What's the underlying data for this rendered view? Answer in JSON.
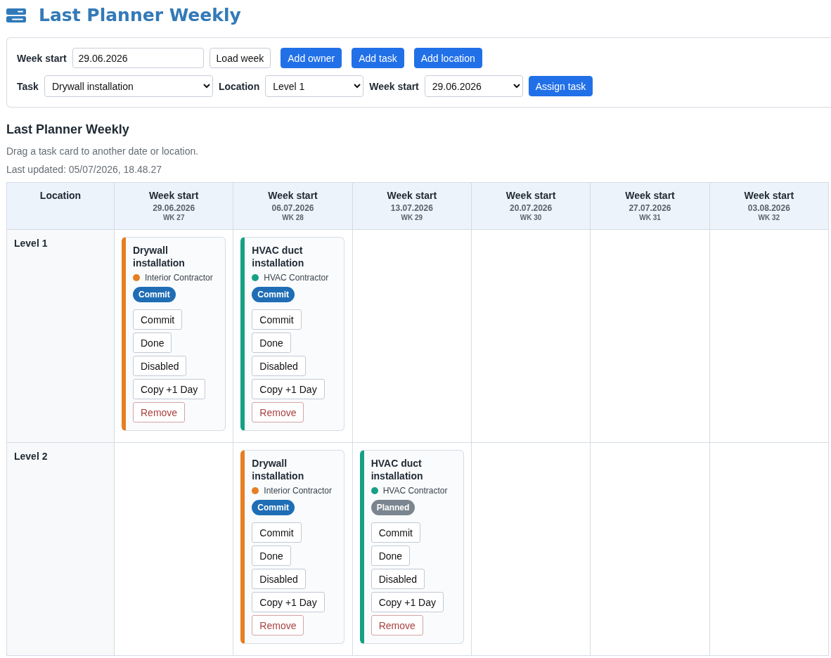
{
  "header": {
    "title": "Last Planner Weekly"
  },
  "toolbar": {
    "week_field": {
      "label": "Week start",
      "value": "29.06.2026"
    },
    "buttons": [
      {
        "label": "Load week",
        "kind": "load"
      },
      {
        "label": "Add owner",
        "kind": "add"
      },
      {
        "label": "Add task",
        "kind": "add"
      },
      {
        "label": "Add location",
        "kind": "add"
      }
    ],
    "task_field": {
      "label": "Task",
      "value": "Drywall installation"
    },
    "location_field": {
      "label": "Location",
      "value": "Level 1"
    },
    "assign_week_field": {
      "label": "Week start",
      "value": "29.06.2026"
    },
    "assign_button": {
      "label": "Assign task",
      "kind": "assign"
    }
  },
  "board": {
    "title": "Last Planner Weekly",
    "hint": "Drag a task card to another date or location.",
    "last_updated": "Last updated: 05/07/2026, 18.48.27",
    "corner": "Location",
    "columns": [
      {
        "label": "Week start",
        "date": "29.06.2026",
        "week": "WK 27"
      },
      {
        "label": "Week start",
        "date": "06.07.2026",
        "week": "WK 28"
      },
      {
        "label": "Week start",
        "date": "13.07.2026",
        "week": "WK 29"
      },
      {
        "label": "Week start",
        "date": "20.07.2026",
        "week": "WK 30"
      },
      {
        "label": "Week start",
        "date": "27.07.2026",
        "week": "WK 31"
      },
      {
        "label": "Week start",
        "date": "03.08.2026",
        "week": "WK 32"
      }
    ],
    "rows": [
      {
        "location": "Level 1",
        "cells": [
          {
            "kind": "card",
            "title": "Drywall installation",
            "owner": "Interior Contractor",
            "color": "#e67e22",
            "status": {
              "label": "Commit",
              "kind": "commit"
            },
            "actions": [
              {
                "label": "Commit",
                "kind": "commit"
              },
              {
                "label": "Done",
                "kind": "done"
              },
              {
                "label": "Disabled",
                "kind": "disable"
              },
              {
                "label": "Copy +1 Day",
                "kind": "copy"
              },
              {
                "label": "Remove",
                "kind": "remove"
              }
            ]
          },
          {
            "kind": "card",
            "title": "HVAC duct installation",
            "owner": "HVAC Contractor",
            "color": "#16a085",
            "status": {
              "label": "Commit",
              "kind": "commit"
            },
            "actions": [
              {
                "label": "Commit",
                "kind": "commit"
              },
              {
                "label": "Done",
                "kind": "done"
              },
              {
                "label": "Disabled",
                "kind": "disable"
              },
              {
                "label": "Copy +1 Day",
                "kind": "copy"
              },
              {
                "label": "Remove",
                "kind": "remove"
              }
            ]
          },
          {
            "kind": "empty"
          },
          {
            "kind": "empty"
          },
          {
            "kind": "empty"
          },
          {
            "kind": "empty"
          }
        ]
      },
      {
        "location": "Level 2",
        "cells": [
          {
            "kind": "empty"
          },
          {
            "kind": "card",
            "title": "Drywall installation",
            "owner": "Interior Contractor",
            "color": "#e67e22",
            "status": {
              "label": "Commit",
              "kind": "commit"
            },
            "actions": [
              {
                "label": "Commit",
                "kind": "commit"
              },
              {
                "label": "Done",
                "kind": "done"
              },
              {
                "label": "Disabled",
                "kind": "disable"
              },
              {
                "label": "Copy +1 Day",
                "kind": "copy"
              },
              {
                "label": "Remove",
                "kind": "remove"
              }
            ]
          },
          {
            "kind": "card",
            "title": "HVAC duct installation",
            "owner": "HVAC Contractor",
            "color": "#16a085",
            "status": {
              "label": "Planned",
              "kind": "planned"
            },
            "actions": [
              {
                "label": "Commit",
                "kind": "commit"
              },
              {
                "label": "Done",
                "kind": "done"
              },
              {
                "label": "Disabled",
                "kind": "disable"
              },
              {
                "label": "Copy +1 Day",
                "kind": "copy"
              },
              {
                "label": "Remove",
                "kind": "remove"
              }
            ]
          },
          {
            "kind": "empty"
          },
          {
            "kind": "empty"
          },
          {
            "kind": "empty"
          }
        ]
      }
    ]
  }
}
